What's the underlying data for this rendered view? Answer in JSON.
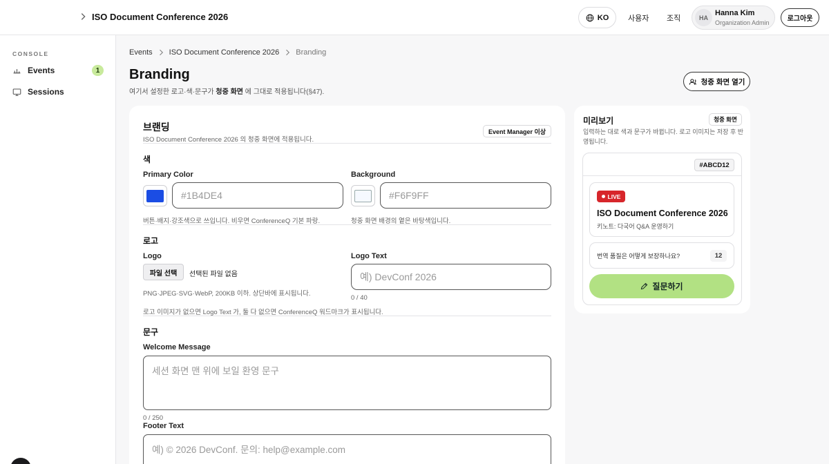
{
  "app": {
    "title": "ISO Document Conference 2026"
  },
  "header": {
    "lang_label": "KO",
    "nav": [
      "사용자",
      "조직"
    ],
    "user": {
      "initials": "HA",
      "name": "Hanna Kim",
      "role": "Organization Admin"
    },
    "logout_label": "로그아웃"
  },
  "sidebar": {
    "section": "CONSOLE",
    "items": [
      {
        "label": "Events",
        "badge": "1",
        "icon": "events-icon"
      },
      {
        "label": "Sessions",
        "icon": "monitor-icon"
      }
    ]
  },
  "breadcrumb": [
    "Events",
    "ISO Document Conference 2026",
    "Branding"
  ],
  "page": {
    "title": "Branding",
    "subtitle_pre": "여기서 설정한 로고·색·문구가 ",
    "subtitle_bold": "청중 화면",
    "subtitle_post": " 에 그대로 적용됩니다(§47).",
    "open_button": "청중 화면 열기"
  },
  "form": {
    "title": "브랜딩",
    "subtitle": "ISO Document Conference 2026 의 청중 화면에 적용됩니다.",
    "role_chip": "Event Manager 이상",
    "color_section": "색",
    "primary": {
      "label": "Primary Color",
      "placeholder": "#1B4DE4",
      "swatch": "#1B4DE4",
      "hint": "버튼·배지·강조색으로 쓰입니다. 비우면 ConferenceQ 기본 파랑."
    },
    "background": {
      "label": "Background",
      "placeholder": "#F6F9FF",
      "swatch": "#F6F9FF",
      "hint": "청중 화면 배경의 옅은 바탕색입니다."
    },
    "logo_section": "로고",
    "logo": {
      "label": "Logo",
      "file_button": "파일 선택",
      "file_status": "선택된 파일 없음",
      "hint": "PNG·JPEG·SVG·WebP, 200KB 이하. 상단바에 표시됩니다."
    },
    "logo_text": {
      "label": "Logo Text",
      "placeholder": "예) DevConf 2026",
      "counter": "0 / 40"
    },
    "logo_note": "로고 이미지가 없으면 Logo Text 가, 둘 다 없으면 ConferenceQ 워드마크가 표시됩니다.",
    "copy_section": "문구",
    "welcome": {
      "label": "Welcome Message",
      "placeholder": "세션 화면 맨 위에 보일 환영 문구",
      "counter": "0 / 250"
    },
    "footer": {
      "label": "Footer Text",
      "placeholder": "예) © 2026 DevConf. 문의: help@example.com"
    }
  },
  "preview": {
    "title": "미리보기",
    "chip": "청중 화면",
    "desc": "입력하는 대로 색과 문구가 바뀝니다. 로고 이미지는 저장 후 반영됩니다.",
    "hex_chip": "#ABCD12",
    "live": "LIVE",
    "event_title": "ISO Document Conference 2026",
    "event_sub": "키노트: 다국어 Q&A 운영하기",
    "question": "번역 품질은 어떻게 보장하나요?",
    "question_count": "12",
    "ask_button": "질문하기",
    "accent": "#B2E183"
  }
}
